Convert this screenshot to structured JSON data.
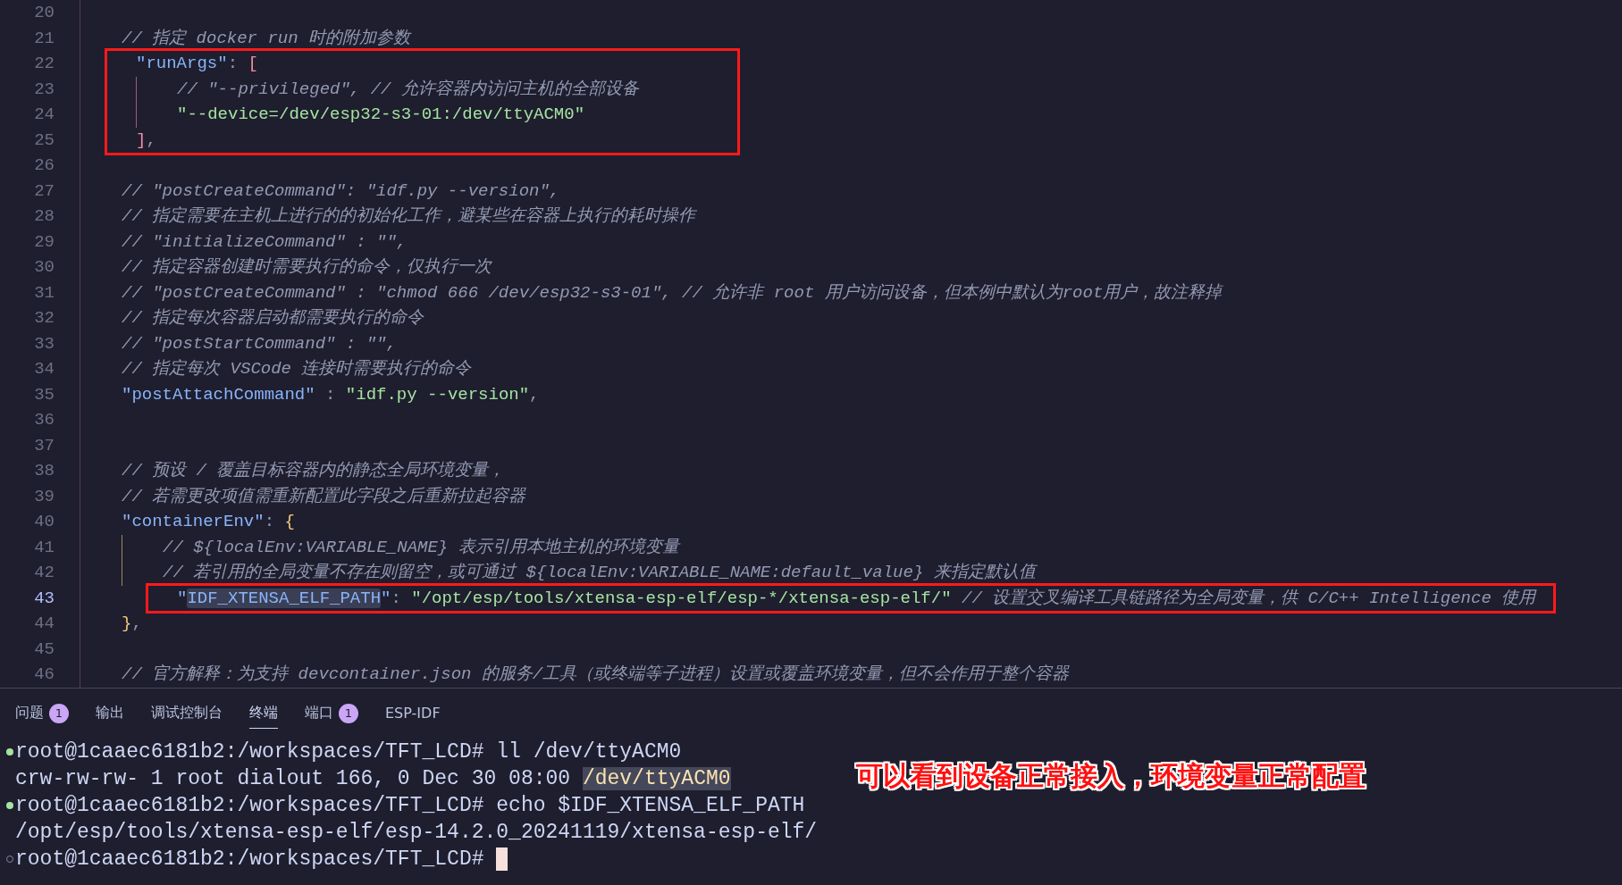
{
  "editor": {
    "lines": [
      {
        "number": "20",
        "current": false,
        "boxed": false
      },
      {
        "number": "21",
        "current": false,
        "boxed": false,
        "tokens": [
          {
            "kind": "comment",
            "text": "// 指定 docker run 时的附加参数"
          }
        ]
      },
      {
        "number": "22",
        "current": false,
        "boxed": true,
        "tokens": [
          {
            "kind": "key",
            "text": "\"runArgs\""
          },
          {
            "kind": "punct",
            "text": ": "
          },
          {
            "kind": "bracket",
            "text": "[",
            "color": "#f38ba8"
          }
        ],
        "children": [
          {
            "number": "23",
            "current": false,
            "boxed": true,
            "tokens": [
              {
                "kind": "comment",
                "text": "// \"--privileged\", // 允许容器内访问主机的全部设备"
              }
            ]
          },
          {
            "number": "24",
            "current": false,
            "boxed": true,
            "tokens": [
              {
                "kind": "string",
                "text": "\"--device=/dev/esp32-s3-01:/dev/ttyACM0\""
              }
            ]
          }
        ]
      },
      {
        "number": "25",
        "current": false,
        "boxed": true,
        "tokens": [
          {
            "kind": "bracket",
            "text": "]",
            "color": "#f38ba8"
          },
          {
            "kind": "punct",
            "text": ","
          }
        ]
      },
      {
        "number": "26",
        "current": false,
        "boxed": false
      },
      {
        "number": "27",
        "current": false,
        "boxed": false,
        "tokens": [
          {
            "kind": "comment",
            "text": "// \"postCreateCommand\": \"idf.py --version\","
          }
        ]
      },
      {
        "number": "28",
        "current": false,
        "boxed": false,
        "tokens": [
          {
            "kind": "comment",
            "text": "// 指定需要在主机上进行的的初始化工作，避某些在容器上执行的耗时操作"
          }
        ]
      },
      {
        "number": "29",
        "current": false,
        "boxed": false,
        "tokens": [
          {
            "kind": "comment",
            "text": "// \"initializeCommand\" : \"\","
          }
        ]
      },
      {
        "number": "30",
        "current": false,
        "boxed": false,
        "tokens": [
          {
            "kind": "comment",
            "text": "// 指定容器创建时需要执行的命令，仅执行一次"
          }
        ]
      },
      {
        "number": "31",
        "current": false,
        "boxed": false,
        "tokens": [
          {
            "kind": "comment",
            "text": "// \"postCreateCommand\" : \"chmod 666 /dev/esp32-s3-01\", // 允许非 root 用户访问设备，但本例中默认为root用户，故注释掉"
          }
        ]
      },
      {
        "number": "32",
        "current": false,
        "boxed": false,
        "tokens": [
          {
            "kind": "comment",
            "text": "// 指定每次容器启动都需要执行的命令"
          }
        ]
      },
      {
        "number": "33",
        "current": false,
        "boxed": false,
        "tokens": [
          {
            "kind": "comment",
            "text": "// \"postStartCommand\" : \"\","
          }
        ]
      },
      {
        "number": "34",
        "current": false,
        "boxed": false,
        "tokens": [
          {
            "kind": "comment",
            "text": "// 指定每次 VSCode 连接时需要执行的命令"
          }
        ]
      },
      {
        "number": "35",
        "current": false,
        "boxed": false,
        "tokens": [
          {
            "kind": "key",
            "text": "\"postAttachCommand\""
          },
          {
            "kind": "punct",
            "text": " : "
          },
          {
            "kind": "string",
            "text": "\"idf.py --version\""
          },
          {
            "kind": "punct",
            "text": ","
          }
        ]
      },
      {
        "number": "36",
        "current": false,
        "boxed": false
      },
      {
        "number": "37",
        "current": false,
        "boxed": false
      },
      {
        "number": "38",
        "current": false,
        "boxed": false,
        "tokens": [
          {
            "kind": "comment",
            "text": "// 预设 / 覆盖目标容器内的静态全局环境变量，"
          }
        ]
      },
      {
        "number": "39",
        "current": false,
        "boxed": false,
        "tokens": [
          {
            "kind": "comment",
            "text": "// 若需更改项值需重新配置此字段之后重新拉起容器"
          }
        ]
      },
      {
        "number": "40",
        "current": false,
        "boxed": false,
        "tokens": [
          {
            "kind": "key",
            "text": "\"containerEnv\""
          },
          {
            "kind": "punct",
            "text": ": "
          },
          {
            "kind": "bracket",
            "text": "{",
            "color": "#f9c97a"
          }
        ],
        "children": [
          {
            "number": "41",
            "current": false,
            "boxed": false,
            "tokens": [
              {
                "kind": "comment",
                "text": "// ${localEnv:VARIABLE_NAME} 表示引用本地主机的环境变量"
              }
            ]
          },
          {
            "number": "42",
            "current": false,
            "boxed": false,
            "tokens": [
              {
                "kind": "comment",
                "text": "// 若引用的全局变量不存在则留空，或可通过 ${localEnv:VARIABLE_NAME:default_value} 来指定默认值"
              }
            ]
          },
          {
            "number": "43",
            "current": true,
            "boxed": true,
            "tokens": [
              {
                "kind": "key",
                "text": "\""
              },
              {
                "kind": "match",
                "text": "IDF_XTENSA_ELF_PATH"
              },
              {
                "kind": "key",
                "text": "\""
              },
              {
                "kind": "punct",
                "text": ": "
              },
              {
                "kind": "string",
                "text": "\"/opt/esp/tools/xtensa-esp-elf/esp-*/xtensa-esp-elf/\""
              },
              {
                "kind": "comment",
                "text": " // 设置交叉编译工具链路径为全局变量，供 C/C++ Intelligence 使用"
              }
            ]
          }
        ]
      },
      {
        "number": "44",
        "current": false,
        "boxed": false,
        "tokens": [
          {
            "kind": "bracket",
            "text": "}",
            "color": "#f9c97a"
          },
          {
            "kind": "punct",
            "text": ","
          }
        ]
      },
      {
        "number": "45",
        "current": false,
        "boxed": false
      },
      {
        "number": "46",
        "current": false,
        "boxed": false,
        "tokens": [
          {
            "kind": "comment",
            "text": "// 官方解释：为支持 devcontainer.json 的服务/工具（或终端等子进程）设置或覆盖环境变量，但不会作用于整个容器"
          }
        ]
      }
    ]
  },
  "panel": {
    "tabs": [
      {
        "label": "问题",
        "badge": "1",
        "selected": false
      },
      {
        "label": "输出",
        "selected": false
      },
      {
        "label": "调试控制台",
        "selected": false
      },
      {
        "label": "终端",
        "selected": true
      },
      {
        "label": "端口",
        "badge": "1",
        "selected": false
      },
      {
        "label": "ESP-IDF",
        "selected": false
      }
    ]
  },
  "terminal": {
    "lines": [
      {
        "kind": "done",
        "cursor": false,
        "segments": [
          {
            "kind": "plain",
            "text": "root@1caaec6181b2:/workspaces/TFT_LCD# ll /dev/ttyACM0"
          }
        ]
      },
      {
        "kind": "output",
        "cursor": false,
        "segments": [
          {
            "kind": "plain",
            "text": "crw-rw-rw- 1 root dialout 166, 0 Dec 30 08:00 "
          },
          {
            "kind": "device",
            "text": "/dev/ttyACM0"
          }
        ]
      },
      {
        "kind": "done",
        "cursor": false,
        "segments": [
          {
            "kind": "plain",
            "text": "root@1caaec6181b2:/workspaces/TFT_LCD# echo $IDF_XTENSA_ELF_PATH"
          }
        ]
      },
      {
        "kind": "output",
        "cursor": false,
        "segments": [
          {
            "kind": "plain",
            "text": "/opt/esp/tools/xtensa-esp-elf/esp-14.2.0_20241119/xtensa-esp-elf/"
          }
        ]
      },
      {
        "kind": "prompt",
        "cursor": true,
        "segments": [
          {
            "kind": "plain",
            "text": "root@1caaec6181b2:/workspaces/TFT_LCD# "
          }
        ]
      }
    ],
    "annotation": "可以看到设备正常接入，环境变量正常配置"
  }
}
